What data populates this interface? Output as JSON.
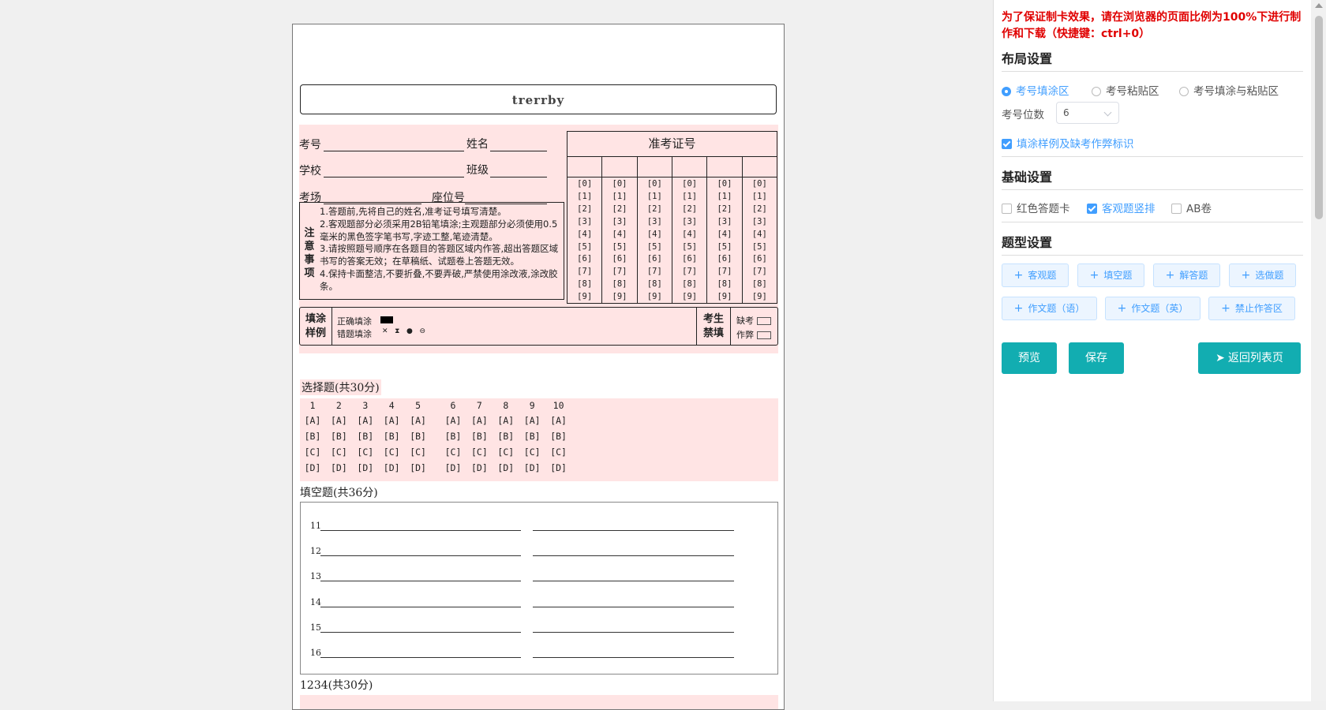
{
  "paper": {
    "title": "trerrby",
    "info": {
      "exam_no": "考号",
      "name": "姓名",
      "school": "学校",
      "class": "班级",
      "room": "考场",
      "seat": "座位号"
    },
    "notice": {
      "title_chars": [
        "注",
        "意",
        "事",
        "项"
      ],
      "lines": [
        "1.答题前,先将自己的姓名,准考证号填写清楚。",
        "2.客观题部分必须采用2B铅笔填涂;主观题部分必须使用0.5毫米的黑色签字笔书写,字迹工整,笔迹清楚。",
        "3.请按照题号顺序在各题目的答题区域内作答,超出答题区域书写的答案无效；在草稿纸、试题卷上答题无效。",
        "4.保持卡面整洁,不要折叠,不要弄破,严禁使用涂改液,涂改胶条。"
      ]
    },
    "admission": {
      "title": "准考证号",
      "digits": [
        "[0]",
        "[1]",
        "[2]",
        "[3]",
        "[4]",
        "[5]",
        "[6]",
        "[7]",
        "[8]",
        "[9]"
      ]
    },
    "fill_sample": {
      "head": [
        "填涂",
        "样例"
      ],
      "correct": "正确填涂",
      "wrong": "错题填涂",
      "wrong_marks": "✕   ⧗   ●   ⊖",
      "student_head": [
        "考生",
        "禁填"
      ],
      "absent": "缺考",
      "cheat": "作弊"
    },
    "choice": {
      "title": "选择题(共30分)",
      "numbers": [
        "1",
        "2",
        "3",
        "4",
        "5",
        "6",
        "7",
        "8",
        "9",
        "10"
      ],
      "options": [
        "[A]",
        "[B]",
        "[C]",
        "[D]"
      ]
    },
    "blank": {
      "title": "填空题(共36分)",
      "numbers": [
        "11",
        "12",
        "13",
        "14",
        "15",
        "16"
      ]
    },
    "essay": {
      "title": "1234(共30分)"
    }
  },
  "panel": {
    "warning": "为了保证制卡效果，请在浏览器的页面比例为100%下进行制作和下载（快捷键：ctrl+0）",
    "layout": {
      "title": "布局设置",
      "radios": [
        {
          "label": "考号填涂区",
          "checked": true
        },
        {
          "label": "考号粘贴区",
          "checked": false
        },
        {
          "label": "考号填涂与粘贴区",
          "checked": false
        }
      ],
      "digits_label": "考号位数",
      "digits_value": "6",
      "sample_check": {
        "label": "填涂样例及缺考作弊标识",
        "checked": true
      }
    },
    "basic": {
      "title": "基础设置",
      "checks": [
        {
          "label": "红色答题卡",
          "checked": false
        },
        {
          "label": "客观题竖排",
          "checked": true
        },
        {
          "label": "AB卷",
          "checked": false
        }
      ]
    },
    "question_types": {
      "title": "题型设置",
      "buttons": [
        "客观题",
        "填空题",
        "解答题",
        "选做题",
        "作文题（语）",
        "作文题（英）",
        "禁止作答区"
      ]
    },
    "actions": {
      "preview": "预览",
      "save": "保存",
      "back": "返回列表页"
    }
  },
  "colors": {
    "accent": "#409eff",
    "teal": "#12adb1",
    "warning": "#e00000",
    "pink": "#ffe4e4"
  }
}
